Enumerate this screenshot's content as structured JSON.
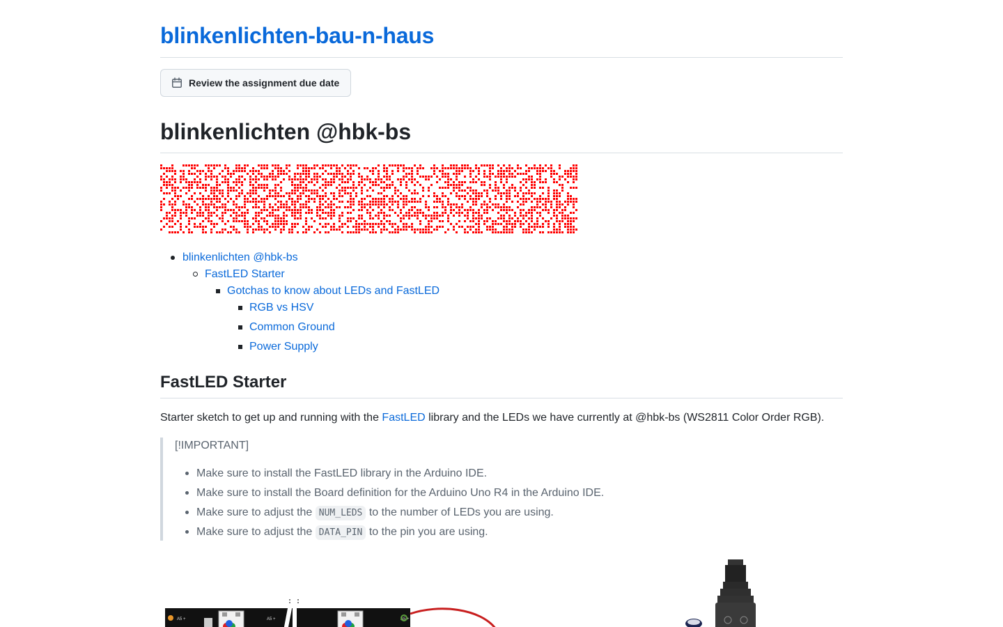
{
  "repo": {
    "title": "blinkenlichten-bau-n-haus"
  },
  "due_button": {
    "label": "Review the assignment due date",
    "icon": "calendar-icon"
  },
  "main_heading": "blinkenlichten @hbk-bs",
  "banner": {
    "type": "led-dot-matrix",
    "color": "#ff0000"
  },
  "toc": {
    "item_1": "blinkenlichten @hbk-bs",
    "item_1_1": "FastLED Starter",
    "item_1_1_1": "Gotchas to know about LEDs and FastLED",
    "item_a": "RGB vs HSV",
    "item_b": "Common Ground",
    "item_c": "Power Supply"
  },
  "section": {
    "heading": "FastLED Starter",
    "para_before": "Starter sketch to get up and running with the ",
    "para_link": "FastLED",
    "para_after": " library and the LEDs we have currently at @hbk-bs (WS2811 Color Order RGB)."
  },
  "callout": {
    "tag": "[!IMPORTANT]",
    "item_1": "Make sure to install the FastLED library in the Arduino IDE.",
    "item_2": "Make sure to install the Board definition for the Arduino Uno R4 in the Arduino IDE.",
    "item_3_before": "Make sure to adjust the ",
    "item_3_code": "NUM_LEDS",
    "item_3_after": " to the number of LEDs you are using.",
    "item_4_before": "Make sure to adjust the ",
    "item_4_code": "DATA_PIN",
    "item_4_after": " to the pin you are using."
  },
  "colors": {
    "link": "#0969da",
    "text": "#1f2328",
    "muted": "#59636e",
    "border": "#d0d7de",
    "led_red": "#ff0000"
  }
}
